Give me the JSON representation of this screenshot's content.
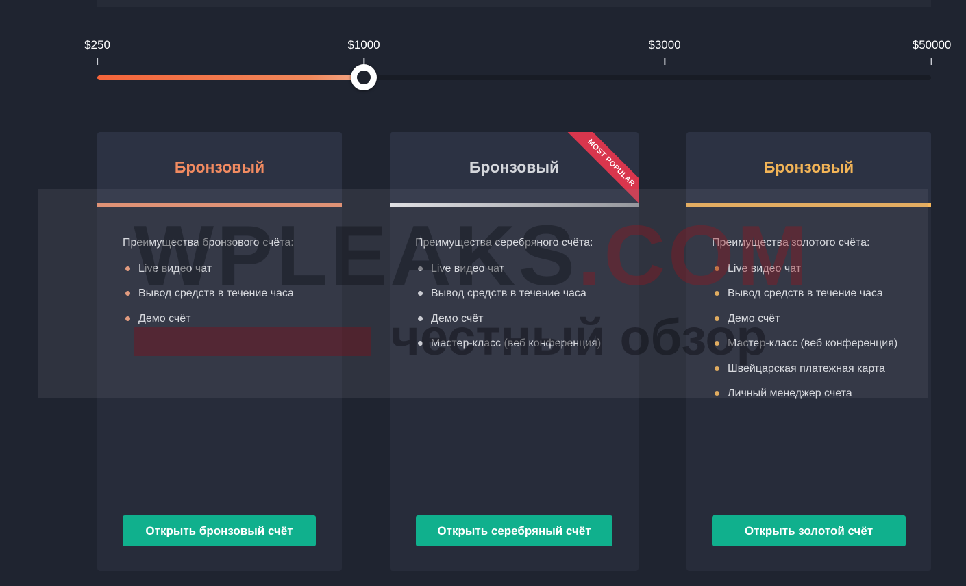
{
  "slider": {
    "ticks": [
      "$250",
      "$1000",
      "$3000",
      "$50000"
    ],
    "selected": "$1000",
    "accent_color": "#f4643a"
  },
  "cards": [
    {
      "title": "Бронзовый",
      "title_color": "#f28b61",
      "line_color": "#f19672",
      "subtitle": "Преимущества бронзового счёта:",
      "bullet_color": "#f3a07c",
      "features": [
        "Live видео чат",
        "Вывод средств в течение часа",
        "Демо счёт"
      ],
      "button": "Открыть бронзовый счёт"
    },
    {
      "title": "Бронзовый",
      "title_color": "#d4d6db",
      "line_color": "#c8c9cc",
      "subtitle": "Преимущества серебряного счёта:",
      "bullet_color": "#d9dbe0",
      "features": [
        "Live видео чат",
        "Вывод средств в течение часа",
        "Демо счёт",
        "Мастер-класс (веб конференция)"
      ],
      "button": "Открыть серебряный счёт",
      "ribbon": "MOST POPULAR"
    },
    {
      "title": "Бронзовый",
      "title_color": "#f2b457",
      "line_color": "#f6b65a",
      "subtitle": "Преимущества золотого счёта:",
      "bullet_color": "#f2b457",
      "features": [
        "Live видео чат",
        "Вывод средств в течение часа",
        "Демо счёт",
        "Мастер-класс (веб конференция)",
        "Швейцарская платежная карта",
        "Личный менеджер счета"
      ],
      "button": "Открыть золотой счёт"
    }
  ],
  "watermark": {
    "main": "WPLEAKS",
    "domain": ".COM",
    "sub": "честный обзор"
  },
  "button_color": "#10b08d"
}
